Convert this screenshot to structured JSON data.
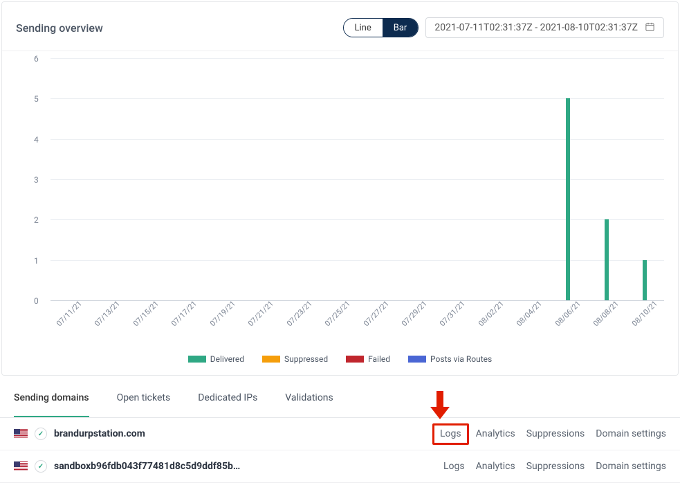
{
  "header": {
    "title": "Sending overview",
    "toggle": {
      "line": "Line",
      "bar": "Bar",
      "active": "bar"
    },
    "date_range": "2021-07-11T02:31:37Z - 2021-08-10T02:31:37Z"
  },
  "chart_data": {
    "type": "bar",
    "title": "Sending overview",
    "xlabel": "",
    "ylabel": "",
    "ylim": [
      0,
      6
    ],
    "yticks": [
      0,
      1,
      2,
      3,
      4,
      5,
      6
    ],
    "categories": [
      "07/11/21",
      "07/13/21",
      "07/15/21",
      "07/17/21",
      "07/19/21",
      "07/21/21",
      "07/23/21",
      "07/25/21",
      "07/27/21",
      "07/29/21",
      "07/31/21",
      "08/02/21",
      "08/04/21",
      "08/06/21",
      "08/08/21",
      "08/10/21"
    ],
    "series": [
      {
        "name": "Delivered",
        "color": "#2fa884",
        "values": [
          0,
          0,
          0,
          0,
          0,
          0,
          0,
          0,
          0,
          0,
          0,
          0,
          0,
          5,
          2,
          1
        ]
      },
      {
        "name": "Suppressed",
        "color": "#f59e0b",
        "values": [
          0,
          0,
          0,
          0,
          0,
          0,
          0,
          0,
          0,
          0,
          0,
          0,
          0,
          0,
          0,
          0
        ]
      },
      {
        "name": "Failed",
        "color": "#c0262d",
        "values": [
          0,
          0,
          0,
          0,
          0,
          0,
          0,
          0,
          0,
          0,
          0,
          0,
          0,
          0,
          0,
          0
        ]
      },
      {
        "name": "Posts via Routes",
        "color": "#4a66d4",
        "values": [
          0,
          0,
          0,
          0,
          0,
          0,
          0,
          0,
          0,
          0,
          0,
          0,
          0,
          0,
          0,
          0
        ]
      }
    ]
  },
  "tabs": {
    "items": [
      {
        "id": "sending-domains",
        "label": "Sending domains",
        "active": true
      },
      {
        "id": "open-tickets",
        "label": "Open tickets"
      },
      {
        "id": "dedicated-ips",
        "label": "Dedicated IPs"
      },
      {
        "id": "validations",
        "label": "Validations"
      }
    ]
  },
  "domain_links": {
    "logs": "Logs",
    "analytics": "Analytics",
    "suppressions": "Suppressions",
    "settings": "Domain settings"
  },
  "domains": [
    {
      "flag": "us",
      "status": "verified",
      "name": "brandurpstation.com",
      "highlight_logs": true
    },
    {
      "flag": "us",
      "status": "verified",
      "name": "sandboxb96fdb043f77481d8c5d9ddf85b…",
      "highlight_logs": false
    }
  ]
}
